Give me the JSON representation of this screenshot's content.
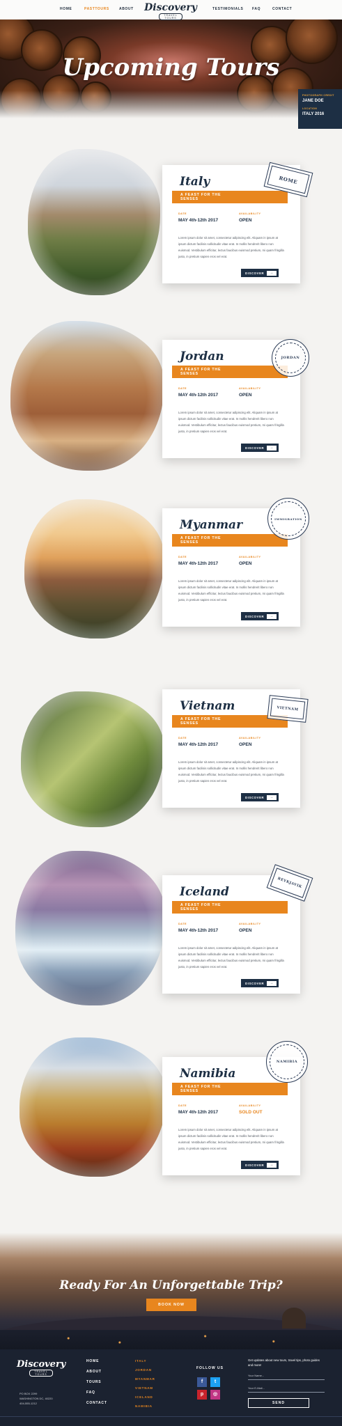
{
  "nav": {
    "left": [
      "HOME",
      "PASTTOURS",
      "ABOUT"
    ],
    "right": [
      "TESTIMONIALS",
      "FAQ",
      "CONTACT"
    ],
    "active": "PASTTOURS"
  },
  "logo": {
    "script": "Discovery",
    "sub": "TRAVEL TOURS"
  },
  "hero": {
    "title": "Upcoming Tours",
    "credit": {
      "photo_label": "PHOTOGRAPH CREDIT",
      "photo_value": "JANE DOE",
      "location_label": "LOCATION",
      "location_value": "ITALY 2016"
    }
  },
  "labels": {
    "date": "DATE",
    "availability": "AVAILABILITY",
    "discover": "DISCOVER"
  },
  "tours": [
    {
      "name": "Italy",
      "tagline": "A FEAST FOR THE SENSES",
      "date": "MAY 4th-12th 2017",
      "availability": "OPEN",
      "stamp": "ROME",
      "body": "Lorem ipsum dolor sit amet, consectetur adipiscing elit. Aliquam in ipsum at ipsum dictum facilisis sollicitudin vitae erat. In mollis hendrerit libero non euismod. Vestibulum efficitur, lectus faucibus euismod pretium, mi quam fringilla justo, in pretium sapien eros vel erat."
    },
    {
      "name": "Jordan",
      "tagline": "A FEAST FOR THE SENSES",
      "date": "MAY 4th-12th 2017",
      "availability": "OPEN",
      "stamp": "JORDAN",
      "body": "Lorem ipsum dolor sit amet, consectetur adipiscing elit. Aliquam in ipsum at ipsum dictum facilisis sollicitudin vitae erat. In mollis hendrerit libero non euismod. Vestibulum efficitur, lectus faucibus euismod pretium, mi quam fringilla justo, in pretium sapien eros vel erat."
    },
    {
      "name": "Myanmar",
      "tagline": "A FEAST FOR THE SENSES",
      "date": "MAY 4th-12th 2017",
      "availability": "OPEN",
      "stamp": "IMMIGRATION",
      "body": "Lorem ipsum dolor sit amet, consectetur adipiscing elit. Aliquam in ipsum at ipsum dictum facilisis sollicitudin vitae erat. In mollis hendrerit libero non euismod. Vestibulum efficitur, lectus faucibus euismod pretium, mi quam fringilla justo, in pretium sapien eros vel erat."
    },
    {
      "name": "Vietnam",
      "tagline": "A FEAST FOR THE SENSES",
      "date": "MAY 4th-12th 2017",
      "availability": "OPEN",
      "stamp": "VIETNAM",
      "body": "Lorem ipsum dolor sit amet, consectetur adipiscing elit. Aliquam in ipsum at ipsum dictum facilisis sollicitudin vitae erat. In mollis hendrerit libero non euismod. Vestibulum efficitur, lectus faucibus euismod pretium, mi quam fringilla justo, in pretium sapien eros vel erat."
    },
    {
      "name": "Iceland",
      "tagline": "A FEAST FOR THE SENSES",
      "date": "MAY 4th-12th 2017",
      "availability": "OPEN",
      "stamp": "REYKJAVIK",
      "body": "Lorem ipsum dolor sit amet, consectetur adipiscing elit. Aliquam in ipsum at ipsum dictum facilisis sollicitudin vitae erat. In mollis hendrerit libero non euismod. Vestibulum efficitur, lectus faucibus euismod pretium, mi quam fringilla justo, in pretium sapien eros vel erat."
    },
    {
      "name": "Namibia",
      "tagline": "A FEAST FOR THE SENSES",
      "date": "MAY 4th-12th 2017",
      "availability": "SOLD OUT",
      "stamp": "NAMIBIA",
      "body": "Lorem ipsum dolor sit amet, consectetur adipiscing elit. Aliquam in ipsum at ipsum dictum facilisis sollicitudin vitae erat. In mollis hendrerit libero non euismod. Vestibulum efficitur, lectus faucibus euismod pretium, mi quam fringilla justo, in pretium sapien eros vel erat."
    }
  ],
  "cta": {
    "title": "Ready For An Unforgettable Trip?",
    "button": "BOOK NOW"
  },
  "footer": {
    "address": [
      "PO BOX 2299",
      "WASHINGTON DC, 40220",
      "404-555-1212"
    ],
    "nav": [
      "HOME",
      "ABOUT",
      "TOURS",
      "FAQ",
      "CONTACT"
    ],
    "destinations": [
      "ITALY",
      "JORDAN",
      "MYANMAR",
      "VIETNAM",
      "ICELAND",
      "NAMIBIA"
    ],
    "follow": "FOLLOW US",
    "newsletter_text": "Get updates about new tours, travel tips, photo guides and more!",
    "name_placeholder": "Your Name...",
    "email_placeholder": "Your E-Mail...",
    "send": "SEND"
  },
  "colors": {
    "accent": "#e8861e",
    "navy": "#1d2f44",
    "footer": "#1b2230"
  }
}
